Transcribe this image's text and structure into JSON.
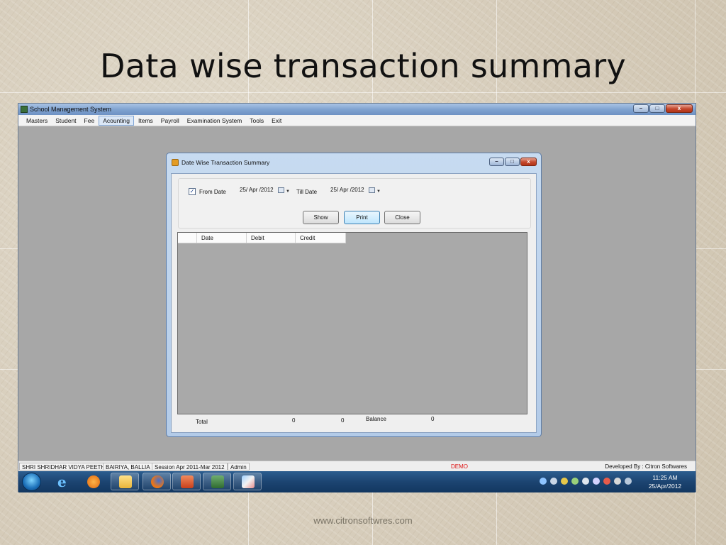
{
  "slide": {
    "title": "Data wise transaction summary",
    "footer": "www.citronsoftwres.com"
  },
  "app": {
    "title": "School Management System",
    "menu": [
      "Masters",
      "Student",
      "Fee",
      "Acounting",
      "Items",
      "Payroll",
      "Examination System",
      "Tools",
      "Exit"
    ],
    "active_menu": "Acounting"
  },
  "dialog": {
    "title": "Date Wise Transaction Summary",
    "from_checked": true,
    "from_label": "From Date",
    "from_value": "25/ Apr /2012",
    "till_label": "Till Date",
    "till_value": "25/ Apr /2012",
    "buttons": {
      "show": "Show",
      "print": "Print",
      "close": "Close"
    },
    "columns": [
      "Date",
      "Debit",
      "Credit"
    ],
    "total_label": "Total",
    "total_debit": "0",
    "total_credit": "0",
    "balance_label": "Balance",
    "balance_value": "0"
  },
  "status": {
    "school": "SHRI SHRIDHAR VIDYA PEETH",
    "location": "BAIRIYA, BALLIA",
    "session": "Session Apr 2011-Mar 2012",
    "user": "Admin",
    "mode": "DEMO",
    "developer": "Developed By : Citron Softwares"
  },
  "taskbar": {
    "time": "11:25 AM",
    "date": "25/Apr/2012"
  },
  "icons": [
    "windows-start-icon",
    "internet-explorer-icon",
    "media-player-icon",
    "folder-icon",
    "firefox-icon",
    "powerpoint-icon",
    "app-icon",
    "paint-icon"
  ],
  "colors": {
    "demo_text": "#dd1111",
    "taskbar": "#1c4471",
    "grid_bg": "#a9a9a9"
  }
}
